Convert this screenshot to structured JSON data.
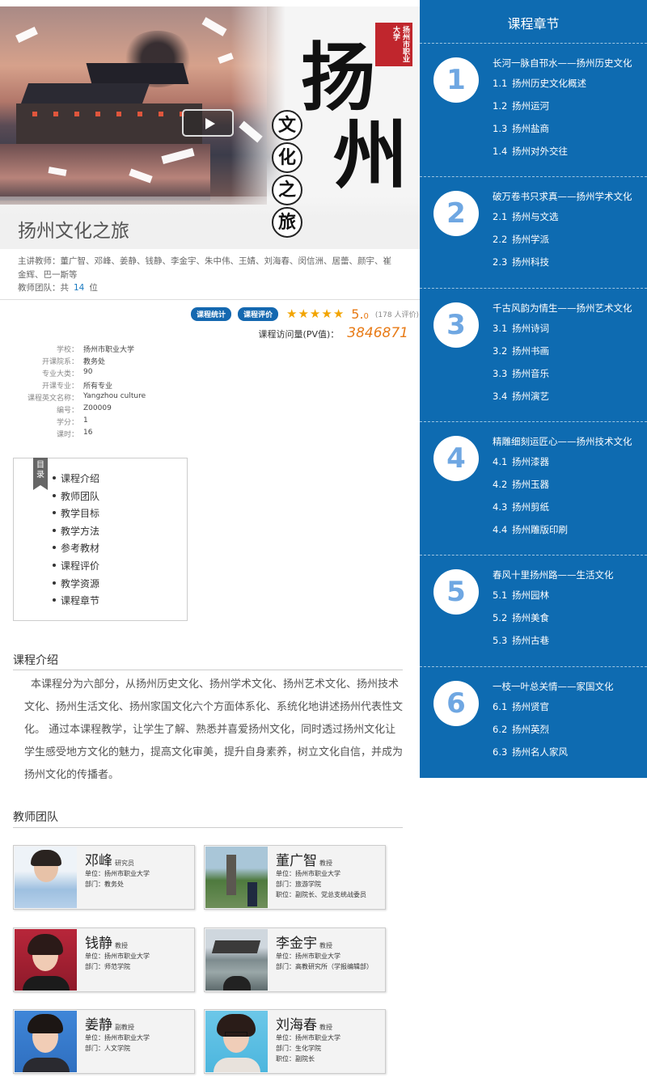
{
  "course": {
    "title": "扬州文化之旅",
    "banner_big_chars": [
      "扬",
      "州"
    ],
    "banner_sub_chars": [
      "文",
      "化",
      "之",
      "旅"
    ],
    "seal_text": "扬州市职业大学",
    "teachers_line": "主讲教师：董广智、邓峰、姜静、钱静、李金宇、朱中伟、王婧、刘海春、闵信洲、居蕾、颜宇、崔金辉、巴一斯等",
    "team_label": "教师团队：共",
    "team_count": "14",
    "team_unit": "位",
    "badge_stats": "课程统计",
    "badge_eval": "课程评价",
    "stars": "★★★★★",
    "score_main": "5.",
    "score_dec": "0",
    "rating_count": "(178 人评价)",
    "pv_label": "课程访问量(PV值)：",
    "pv_value": "3846871"
  },
  "info": [
    {
      "k": "学校：",
      "v": "扬州市职业大学"
    },
    {
      "k": "开课院系：",
      "v": "教务处"
    },
    {
      "k": "专业大类：",
      "v": "90"
    },
    {
      "k": "开课专业：",
      "v": "所有专业"
    },
    {
      "k": "课程英文名称：",
      "v": "Yangzhou culture"
    },
    {
      "k": "编号：",
      "v": "Z00009"
    },
    {
      "k": "学分：",
      "v": "1"
    },
    {
      "k": "课时：",
      "v": "16"
    }
  ],
  "toc": {
    "tag": "目录",
    "items": [
      "课程介绍",
      "教师团队",
      "教学目标",
      "教学方法",
      "参考教材",
      "课程评价",
      "教学资源",
      "课程章节"
    ]
  },
  "intro": {
    "title": "课程介绍",
    "text": "本课程分为六部分，从扬州历史文化、扬州学术文化、扬州艺术文化、扬州技术文化、扬州生活文化、扬州家国文化六个方面体系化、系统化地讲述扬州代表性文化。 通过本课程教学，让学生了解、熟悉并喜爱扬州文化，同时透过扬州文化让学生感受地方文化的魅力，提高文化审美，提升自身素养，树立文化自信，并成为扬州文化的传播者。"
  },
  "team": {
    "title": "教师团队",
    "members": [
      {
        "name": "邓峰",
        "rank": "研究员",
        "l1": "单位：扬州市职业大学",
        "l2": "部门：教务处",
        "l3": ""
      },
      {
        "name": "董广智",
        "rank": "教授",
        "l1": "单位：扬州市职业大学",
        "l2": "部门：旅游学院",
        "l3": "职位：副院长、党总支统战委员"
      },
      {
        "name": "钱静",
        "rank": "教授",
        "l1": "单位：扬州市职业大学",
        "l2": "部门：师范学院",
        "l3": ""
      },
      {
        "name": "李金宇",
        "rank": "教授",
        "l1": "单位：扬州市职业大学",
        "l2": "部门：高教研究所（学报编辑部）",
        "l3": ""
      },
      {
        "name": "姜静",
        "rank": "副教授",
        "l1": "单位：扬州市职业大学",
        "l2": "部门：人文学院",
        "l3": ""
      },
      {
        "name": "刘海春",
        "rank": "教授",
        "l1": "单位：扬州市职业大学",
        "l2": "部门：生化学院",
        "l3": "职位：副院长"
      }
    ]
  },
  "chapters": {
    "header": "课程章节",
    "list": [
      {
        "num": "1",
        "title": "长河一脉自邗水——扬州历史文化",
        "items": [
          [
            "1.1",
            "扬州历史文化概述"
          ],
          [
            "1.2",
            "扬州运河"
          ],
          [
            "1.3",
            "扬州盐商"
          ],
          [
            "1.4",
            "扬州对外交往"
          ]
        ]
      },
      {
        "num": "2",
        "title": "破万卷书只求真——扬州学术文化",
        "items": [
          [
            "2.1",
            "扬州与文选"
          ],
          [
            "2.2",
            "扬州学派"
          ],
          [
            "2.3",
            "扬州科技"
          ]
        ]
      },
      {
        "num": "3",
        "title": "千古风韵为情生——扬州艺术文化",
        "items": [
          [
            "3.1",
            "扬州诗词"
          ],
          [
            "3.2",
            "扬州书画"
          ],
          [
            "3.3",
            "扬州音乐"
          ],
          [
            "3.4",
            "扬州演艺"
          ]
        ]
      },
      {
        "num": "4",
        "title": "精雕细刻运匠心——扬州技术文化",
        "items": [
          [
            "4.1",
            "扬州漆器"
          ],
          [
            "4.2",
            "扬州玉器"
          ],
          [
            "4.3",
            "扬州剪纸"
          ],
          [
            "4.4",
            "扬州雕版印刷"
          ]
        ]
      },
      {
        "num": "5",
        "title": "春风十里扬州路——生活文化",
        "items": [
          [
            "5.1",
            "扬州园林"
          ],
          [
            "5.2",
            "扬州美食"
          ],
          [
            "5.3",
            "扬州古巷"
          ]
        ]
      },
      {
        "num": "6",
        "title": "一枝一叶总关情——家国文化",
        "items": [
          [
            "6.1",
            "扬州贤官"
          ],
          [
            "6.2",
            "扬州英烈"
          ],
          [
            "6.3",
            "扬州名人家风"
          ]
        ]
      }
    ]
  }
}
